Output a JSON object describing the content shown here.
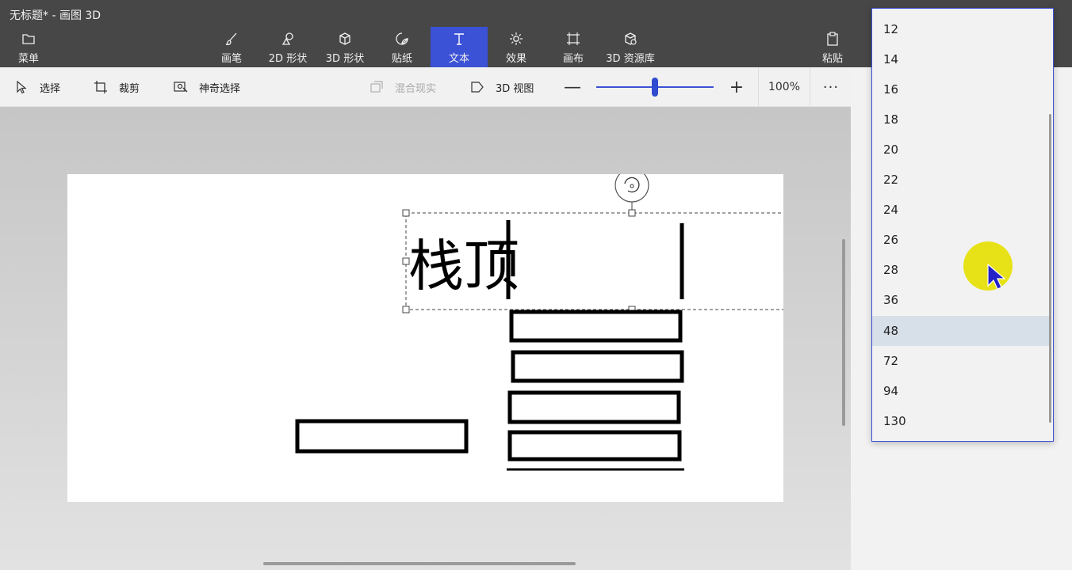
{
  "window": {
    "title": "无标题* - 画图 3D"
  },
  "ribbon": {
    "menu_label": "菜单",
    "tools": [
      {
        "label": "画笔",
        "icon": "brush-icon"
      },
      {
        "label": "2D 形状",
        "icon": "2d-shapes-icon"
      },
      {
        "label": "3D 形状",
        "icon": "3d-shapes-icon"
      },
      {
        "label": "贴纸",
        "icon": "sticker-icon"
      },
      {
        "label": "文本",
        "icon": "text-icon",
        "active": true
      },
      {
        "label": "效果",
        "icon": "effects-icon"
      },
      {
        "label": "画布",
        "icon": "canvas-icon"
      },
      {
        "label": "3D 资源库",
        "icon": "3d-library-icon"
      }
    ],
    "paste_label": "粘贴",
    "accent_color": "#3b51d6"
  },
  "toolbar": {
    "select_label": "选择",
    "crop_label": "裁剪",
    "magic_select_label": "神奇选择",
    "mixed_reality_label": "混合现实",
    "view3d_label": "3D 视图",
    "zoom_minus": "—",
    "zoom_plus": "+",
    "zoom_value": "100%",
    "zoom_fraction": 0.5,
    "more_label": "···"
  },
  "canvas": {
    "text": "栈顶"
  },
  "font_size_dropdown": {
    "options": [
      "12",
      "14",
      "16",
      "18",
      "20",
      "22",
      "24",
      "26",
      "28",
      "36",
      "48",
      "72",
      "94",
      "130"
    ],
    "selected": "48"
  }
}
